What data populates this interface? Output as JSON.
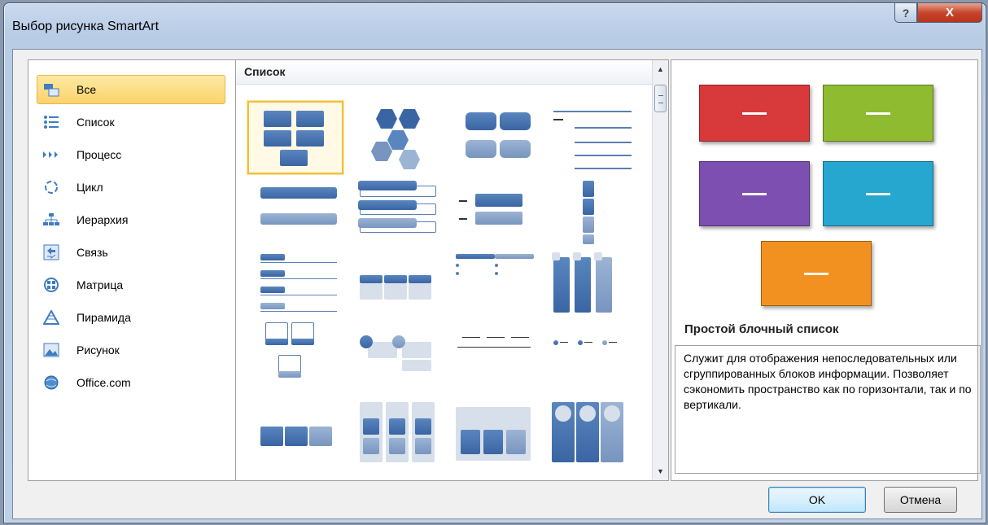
{
  "window": {
    "title": "Выбор рисунка SmartArt",
    "help_label": "?",
    "close_label": "X"
  },
  "categories": [
    {
      "label": "Все",
      "icon": "all-icon",
      "selected": true
    },
    {
      "label": "Список",
      "icon": "list-icon"
    },
    {
      "label": "Процесс",
      "icon": "process-icon"
    },
    {
      "label": "Цикл",
      "icon": "cycle-icon"
    },
    {
      "label": "Иерархия",
      "icon": "hierarchy-icon"
    },
    {
      "label": "Связь",
      "icon": "relationship-icon"
    },
    {
      "label": "Матрица",
      "icon": "matrix-icon"
    },
    {
      "label": "Пирамида",
      "icon": "pyramid-icon"
    },
    {
      "label": "Рисунок",
      "icon": "picture-icon"
    },
    {
      "label": "Office.com",
      "icon": "office-com-icon"
    }
  ],
  "gallery": {
    "header": "Список",
    "selected_index": 0
  },
  "preview": {
    "title": "Простой блочный список",
    "description": "Служит для отображения непоследовательных или сгруппированных блоков информации. Позволяет сэкономить пространство как по горизонтали, так и по вертикали.",
    "colors": [
      "#d8393a",
      "#8fbb30",
      "#7d4fb1",
      "#25a7cf",
      "#f39120"
    ]
  },
  "buttons": {
    "ok": "OK",
    "cancel": "Отмена"
  }
}
